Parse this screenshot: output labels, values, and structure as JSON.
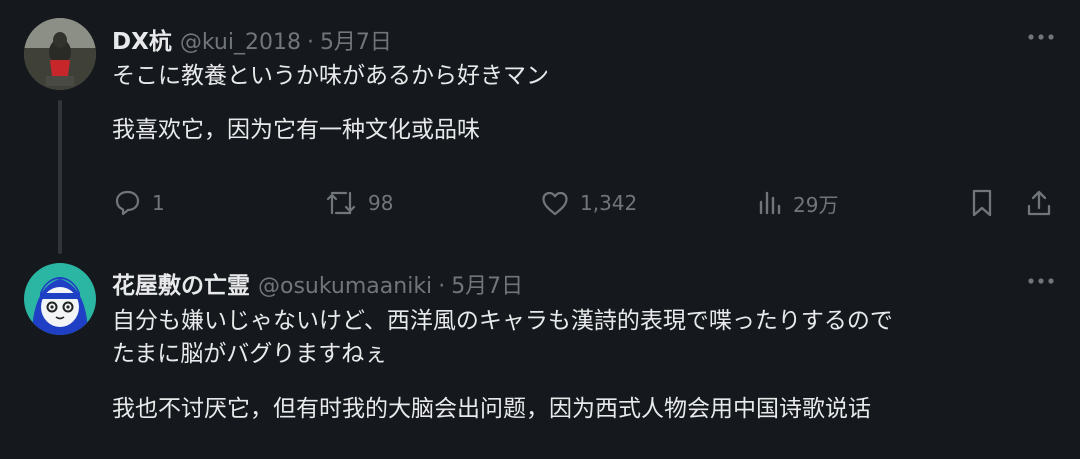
{
  "tweets": [
    {
      "display_name": "DX杭",
      "handle": "@kui_2018",
      "separator": "·",
      "date": "5月7日",
      "text_lines": [
        "そこに教養というか味があるから好きマン"
      ],
      "translation": "我喜欢它，因为它有一种文化或品味",
      "actions": {
        "reply_count": "1",
        "repost_count": "98",
        "like_count": "1,342",
        "views_count": "29万"
      }
    },
    {
      "display_name": "花屋敷の亡霊",
      "handle": "@osukumaaniki",
      "separator": "·",
      "date": "5月7日",
      "text_lines": [
        "自分も嫌いじゃないけど、西洋風のキャラも漢詩的表現で喋ったりするので",
        "たまに脳がバグりますねぇ"
      ],
      "translation": "我也不讨厌它，但有时我的大脑会出问题，因为西式人物会用中国诗歌说话"
    }
  ],
  "icons": {
    "more": "more-horizontal-icon",
    "reply": "reply-bubble-icon",
    "repost": "repost-arrows-icon",
    "like": "heart-icon",
    "views": "views-bar-chart-icon",
    "bookmark": "bookmark-icon",
    "share": "share-upload-icon"
  },
  "colors": {
    "background": "#15181c",
    "primary_text": "#e7e9ea",
    "secondary_text": "#71767b",
    "thread_line": "#333639"
  }
}
